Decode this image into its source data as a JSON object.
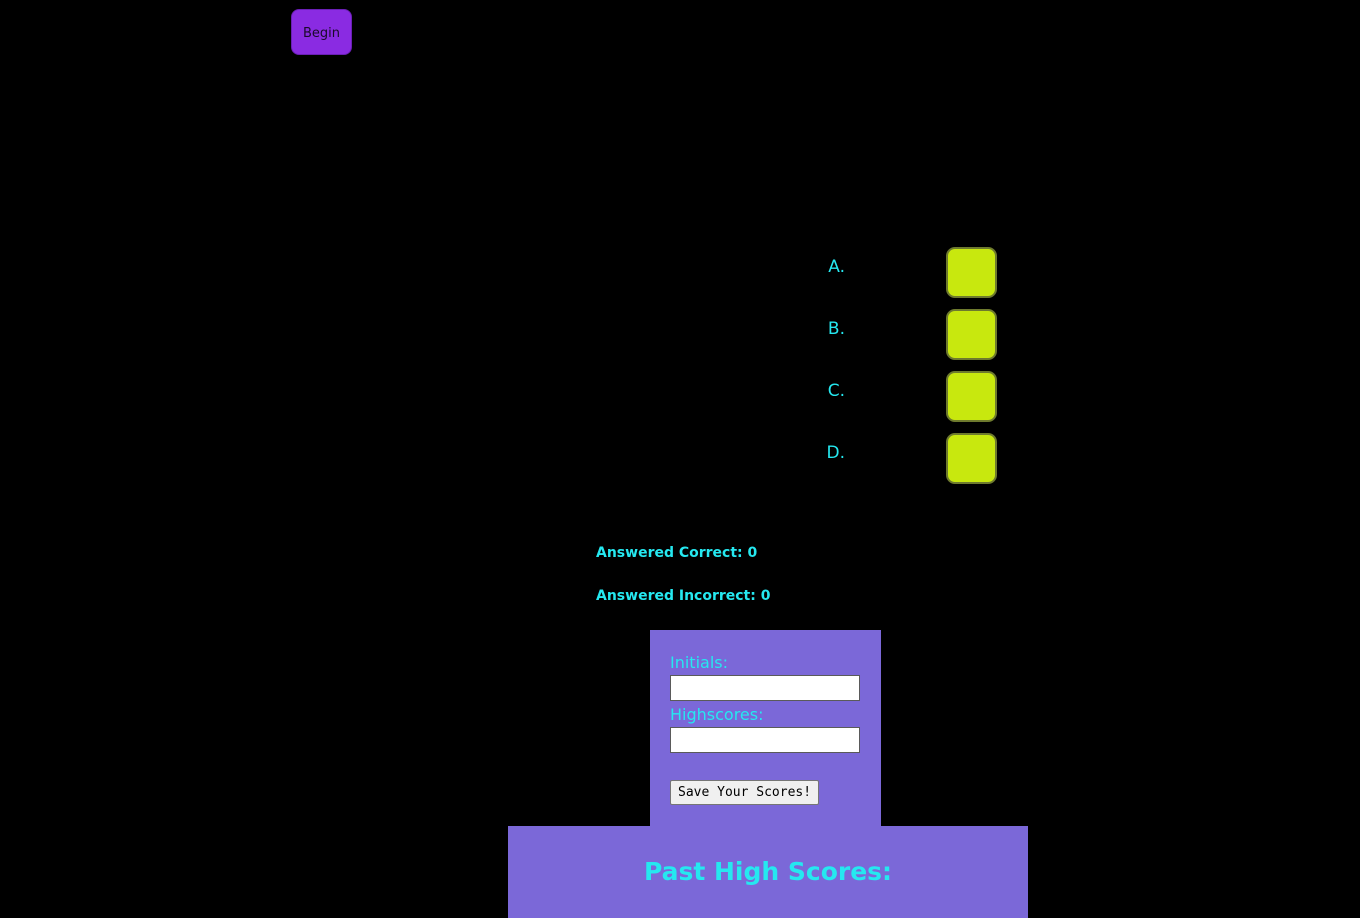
{
  "controls": {
    "begin_label": "Begin"
  },
  "answers": [
    {
      "letter": "A."
    },
    {
      "letter": "B."
    },
    {
      "letter": "C."
    },
    {
      "letter": "D."
    }
  ],
  "stats": {
    "correct_label": "Answered Correct: 0",
    "incorrect_label": "Answered Incorrect: 0"
  },
  "form": {
    "initials_label": "Initials:",
    "initials_value": "",
    "highscores_label": "Highscores:",
    "highscores_value": "",
    "save_label": "Save Your Scores!"
  },
  "scores": {
    "title": "Past High Scores:"
  },
  "colors": {
    "background": "#000000",
    "accent_text": "#25e8f0",
    "begin_button": "#8a2be2",
    "answer_box": "#c8e80e",
    "panel": "#7b68d8"
  }
}
